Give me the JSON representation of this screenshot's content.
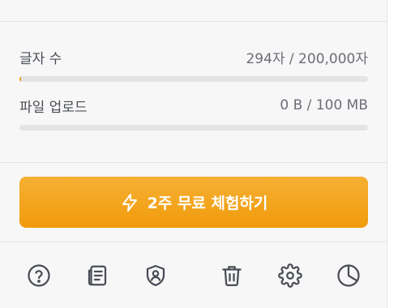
{
  "usage": {
    "characters": {
      "label": "글자 수",
      "value": "294자 / 200,000자",
      "fill_fraction": 0.00147
    },
    "upload": {
      "label": "파일 업로드",
      "value": "0 B / 100 MB",
      "fill_fraction": 0
    }
  },
  "trial_button": {
    "label": "2주 무료 체험하기",
    "icon": "lightning-icon"
  },
  "toolbar": {
    "icons": [
      "help-icon",
      "document-icon",
      "shield-icon",
      "trash-icon",
      "gear-icon",
      "pie-chart-icon"
    ]
  },
  "colors": {
    "accent": "#f29e10",
    "panel_bg": "#f7f7f8",
    "track": "#e4e4e7",
    "icon": "#4a4d55"
  }
}
